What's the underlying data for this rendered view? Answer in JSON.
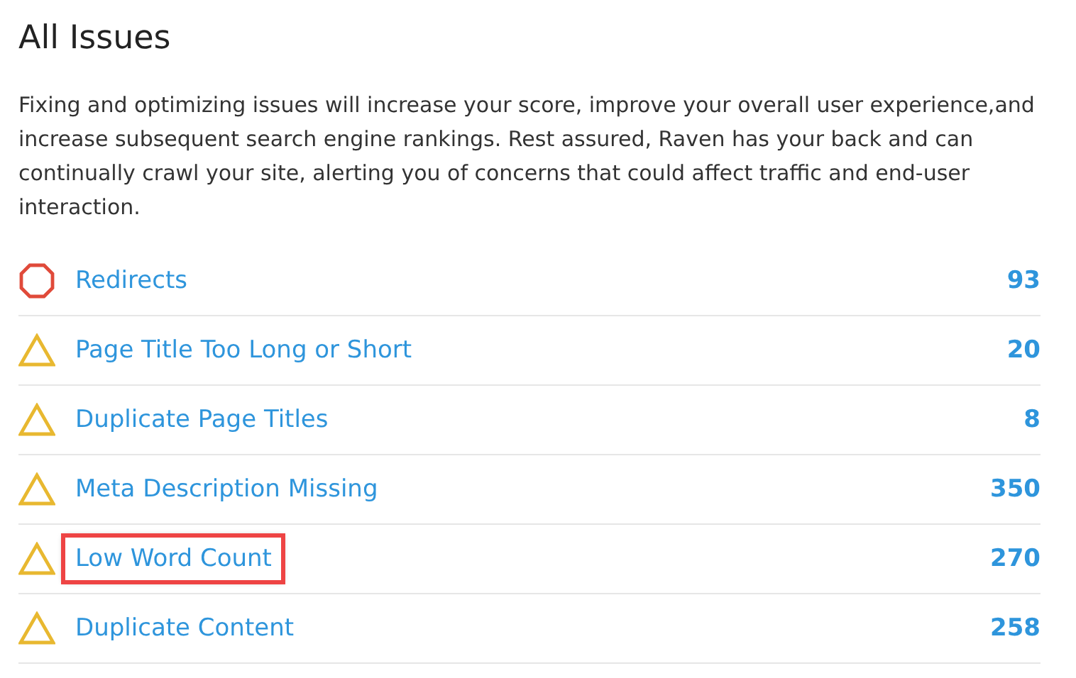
{
  "title": "All Issues",
  "description": "Fixing and optimizing issues will increase your score, improve your overall user experience,and increase subsequent search engine rankings. Rest assured, Raven has your back and can continually crawl your site, alerting you of concerns that could affect traffic and end-user interaction.",
  "issues": [
    {
      "kind": "error",
      "label": "Redirects",
      "count": "93",
      "highlighted": false
    },
    {
      "kind": "warning",
      "label": "Page Title Too Long or Short",
      "count": "20",
      "highlighted": false
    },
    {
      "kind": "warning",
      "label": "Duplicate Page Titles",
      "count": "8",
      "highlighted": false
    },
    {
      "kind": "warning",
      "label": "Meta Description Missing",
      "count": "350",
      "highlighted": false
    },
    {
      "kind": "warning",
      "label": "Low Word Count",
      "count": "270",
      "highlighted": true
    },
    {
      "kind": "warning",
      "label": "Duplicate Content",
      "count": "258",
      "highlighted": false
    }
  ]
}
